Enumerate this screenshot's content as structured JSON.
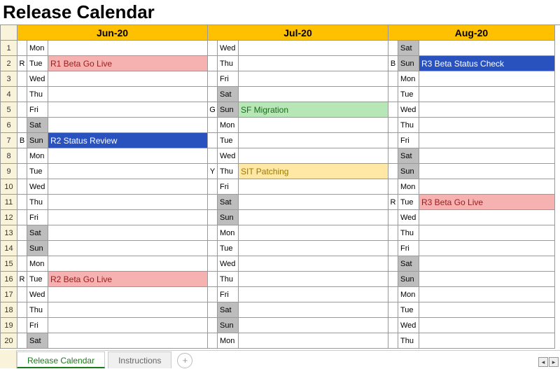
{
  "title": "Release Calendar",
  "months": {
    "jun": "Jun-20",
    "jul": "Jul-20",
    "aug": "Aug-20"
  },
  "rows": [
    {
      "n": "1",
      "jf": "",
      "jd": "Mon",
      "je": "",
      "jc": "",
      "lf": "",
      "ld": "Wed",
      "le": "",
      "lc": "",
      "af": "",
      "ad": "Sat",
      "ae": "",
      "ac": "",
      "aw": true
    },
    {
      "n": "2",
      "jf": "R",
      "jd": "Tue",
      "je": "R1 Beta Go Live",
      "jc": "r",
      "lf": "",
      "ld": "Thu",
      "le": "",
      "lc": "",
      "af": "B",
      "ad": "Sun",
      "ae": "R3 Beta Status Check",
      "ac": "b",
      "aw": true
    },
    {
      "n": "3",
      "jf": "",
      "jd": "Wed",
      "je": "",
      "jc": "",
      "lf": "",
      "ld": "Fri",
      "le": "",
      "lc": "",
      "af": "",
      "ad": "Mon",
      "ae": "",
      "ac": ""
    },
    {
      "n": "4",
      "jf": "",
      "jd": "Thu",
      "je": "",
      "jc": "",
      "lf": "",
      "ld": "Sat",
      "le": "",
      "lc": "",
      "lw": true,
      "af": "",
      "ad": "Tue",
      "ae": "",
      "ac": ""
    },
    {
      "n": "5",
      "jf": "",
      "jd": "Fri",
      "je": "",
      "jc": "",
      "lf": "G",
      "ld": "Sun",
      "le": "SF Migration",
      "lc": "g",
      "lw": true,
      "af": "",
      "ad": "Wed",
      "ae": "",
      "ac": ""
    },
    {
      "n": "6",
      "jf": "",
      "jd": "Sat",
      "je": "",
      "jc": "",
      "jw": true,
      "lf": "",
      "ld": "Mon",
      "le": "",
      "lc": "",
      "af": "",
      "ad": "Thu",
      "ae": "",
      "ac": ""
    },
    {
      "n": "7",
      "jf": "B",
      "jd": "Sun",
      "je": "R2 Status Review",
      "jc": "b",
      "jw": true,
      "lf": "",
      "ld": "Tue",
      "le": "",
      "lc": "",
      "af": "",
      "ad": "Fri",
      "ae": "",
      "ac": ""
    },
    {
      "n": "8",
      "jf": "",
      "jd": "Mon",
      "je": "",
      "jc": "",
      "lf": "",
      "ld": "Wed",
      "le": "",
      "lc": "",
      "af": "",
      "ad": "Sat",
      "ae": "",
      "ac": "",
      "aw": true
    },
    {
      "n": "9",
      "jf": "",
      "jd": "Tue",
      "je": "",
      "jc": "",
      "lf": "Y",
      "ld": "Thu",
      "le": "SIT Patching",
      "lc": "y",
      "af": "",
      "ad": "Sun",
      "ae": "",
      "ac": "",
      "aw": true
    },
    {
      "n": "10",
      "jf": "",
      "jd": "Wed",
      "je": "",
      "jc": "",
      "lf": "",
      "ld": "Fri",
      "le": "",
      "lc": "",
      "af": "",
      "ad": "Mon",
      "ae": "",
      "ac": ""
    },
    {
      "n": "11",
      "jf": "",
      "jd": "Thu",
      "je": "",
      "jc": "",
      "lf": "",
      "ld": "Sat",
      "le": "",
      "lc": "",
      "lw": true,
      "af": "R",
      "ad": "Tue",
      "ae": "R3 Beta Go Live",
      "ac": "r"
    },
    {
      "n": "12",
      "jf": "",
      "jd": "Fri",
      "je": "",
      "jc": "",
      "lf": "",
      "ld": "Sun",
      "le": "",
      "lc": "",
      "lw": true,
      "af": "",
      "ad": "Wed",
      "ae": "",
      "ac": ""
    },
    {
      "n": "13",
      "jf": "",
      "jd": "Sat",
      "je": "",
      "jc": "",
      "jw": true,
      "lf": "",
      "ld": "Mon",
      "le": "",
      "lc": "",
      "af": "",
      "ad": "Thu",
      "ae": "",
      "ac": ""
    },
    {
      "n": "14",
      "jf": "",
      "jd": "Sun",
      "je": "",
      "jc": "",
      "jw": true,
      "lf": "",
      "ld": "Tue",
      "le": "",
      "lc": "",
      "af": "",
      "ad": "Fri",
      "ae": "",
      "ac": ""
    },
    {
      "n": "15",
      "jf": "",
      "jd": "Mon",
      "je": "",
      "jc": "",
      "lf": "",
      "ld": "Wed",
      "le": "",
      "lc": "",
      "af": "",
      "ad": "Sat",
      "ae": "",
      "ac": "",
      "aw": true
    },
    {
      "n": "16",
      "jf": "R",
      "jd": "Tue",
      "je": "R2 Beta Go Live",
      "jc": "r",
      "lf": "",
      "ld": "Thu",
      "le": "",
      "lc": "",
      "af": "",
      "ad": "Sun",
      "ae": "",
      "ac": "",
      "aw": true
    },
    {
      "n": "17",
      "jf": "",
      "jd": "Wed",
      "je": "",
      "jc": "",
      "lf": "",
      "ld": "Fri",
      "le": "",
      "lc": "",
      "af": "",
      "ad": "Mon",
      "ae": "",
      "ac": ""
    },
    {
      "n": "18",
      "jf": "",
      "jd": "Thu",
      "je": "",
      "jc": "",
      "lf": "",
      "ld": "Sat",
      "le": "",
      "lc": "",
      "lw": true,
      "af": "",
      "ad": "Tue",
      "ae": "",
      "ac": ""
    },
    {
      "n": "19",
      "jf": "",
      "jd": "Fri",
      "je": "",
      "jc": "",
      "lf": "",
      "ld": "Sun",
      "le": "",
      "lc": "",
      "lw": true,
      "af": "",
      "ad": "Wed",
      "ae": "",
      "ac": ""
    },
    {
      "n": "20",
      "jf": "",
      "jd": "Sat",
      "je": "",
      "jc": "",
      "jw": true,
      "lf": "",
      "ld": "Mon",
      "le": "",
      "lc": "",
      "af": "",
      "ad": "Thu",
      "ae": "",
      "ac": ""
    }
  ],
  "tabs": {
    "active": "Release Calendar",
    "other": "Instructions",
    "add": "+"
  },
  "scroll": {
    "left": "◂",
    "right": "▸"
  }
}
